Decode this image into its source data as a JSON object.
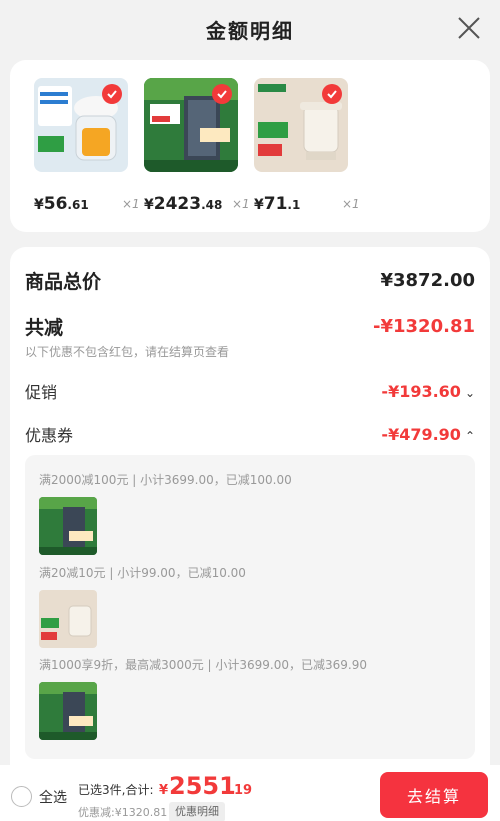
{
  "header": {
    "title": "金额明细"
  },
  "products": [
    {
      "price_symbol": "¥",
      "price_int": "56",
      "price_dec": ".61",
      "qty": "×1",
      "thumb": "blender-icon"
    },
    {
      "price_symbol": "¥",
      "price_int": "2423",
      "price_dec": ".48",
      "qty": "×1",
      "thumb": "refrigerator-icon"
    },
    {
      "price_symbol": "¥",
      "price_int": "71",
      "price_dec": ".1",
      "qty": "×1",
      "thumb": "kettle-icon"
    }
  ],
  "summary": {
    "total_label": "商品总价",
    "total_value": "¥3872.00",
    "discount_label": "共减",
    "discount_value": "-¥1320.81",
    "note": "以下优惠不包含红包，请在结算页查看",
    "promo_label": "促销",
    "promo_value": "-¥193.60",
    "coupon_label": "优惠券",
    "coupon_value": "-¥479.90"
  },
  "coupons": [
    {
      "text": "满2000减100元 | 小计3699.00，已减100.00",
      "thumb": "refrigerator-icon"
    },
    {
      "text": "满20减10元 | 小计99.00，已减10.00",
      "thumb": "kettle-icon"
    },
    {
      "text": "满1000享9折，最高减3000元 | 小计3699.00，已减369.90",
      "thumb": "refrigerator-icon"
    }
  ],
  "bottom": {
    "select_all": "全选",
    "selected_text": "已选3件,合计:",
    "total_symbol": "¥",
    "total_int": "2551",
    "total_dec": ".19",
    "saved_text": "优惠减:¥1320.81",
    "detail_tag": "优惠明细",
    "pay_label": "去结算"
  },
  "colors": {
    "accent": "#f23a3a",
    "pay_button": "#f5333f"
  }
}
